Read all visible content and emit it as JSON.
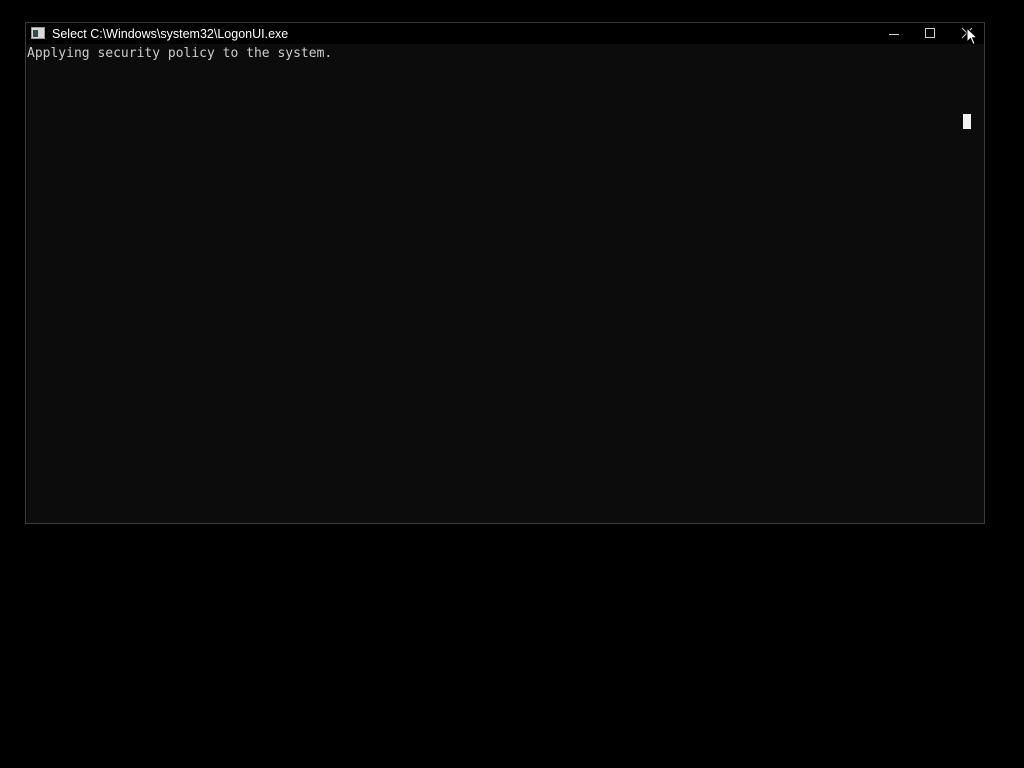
{
  "window": {
    "title": "Select C:\\Windows\\system32\\LogonUI.exe",
    "icon": "console-app-icon",
    "controls": {
      "minimize_icon": "minimize-icon",
      "maximize_icon": "maximize-icon",
      "close_icon": "close-icon"
    }
  },
  "console": {
    "lines": [
      "Applying security policy to the system."
    ],
    "cursor_icon": "text-cursor-block"
  },
  "colors": {
    "desktop_background": "#000000",
    "console_background": "#0c0c0c",
    "console_text": "#cccccc",
    "title_text": "#ffffff",
    "window_border": "#3a3a3a"
  }
}
